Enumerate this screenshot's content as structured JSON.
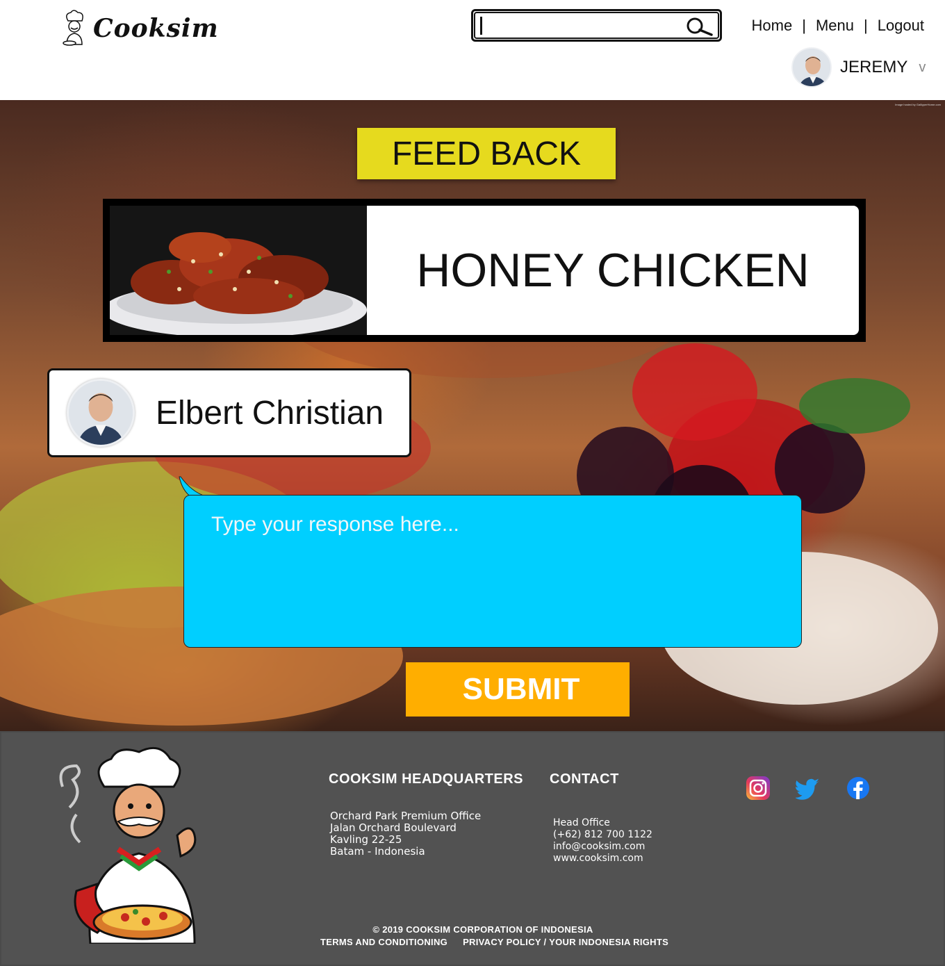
{
  "header": {
    "logo_text": "Cooksim",
    "search": {
      "placeholder": "",
      "value": ""
    },
    "nav": [
      {
        "label": "Home"
      },
      {
        "label": "Menu"
      },
      {
        "label": "Logout"
      }
    ],
    "nav_separator": "|",
    "user": {
      "name": "JEREMY",
      "caret": "v"
    }
  },
  "hero": {
    "credit": "Image hosted by GalliyperHome.com",
    "title": "FEED BACK",
    "dish_name": "HONEY CHICKEN",
    "reviewer_name": "Elbert Christian",
    "response_placeholder": "Type your response here...",
    "submit_label": "SUBMIT"
  },
  "footer": {
    "hq_title": "COOKSIM HEADQUARTERS",
    "hq_lines": [
      "Orchard Park Premium Office",
      "Jalan Orchard Boulevard",
      "Kavling 22-25",
      "Batam - Indonesia"
    ],
    "contact_title": "CONTACT",
    "contact_lines": [
      "Head Office",
      "(+62) 812 700 1122",
      "info@cooksim.com",
      "www.cooksim.com"
    ],
    "social_icons": [
      "instagram-icon",
      "twitter-icon",
      "facebook-icon"
    ],
    "copyright": "© 2019 COOKSIM CORPORATION OF INDONESIA",
    "terms": "TERMS AND CONDITIONING",
    "privacy": "PRIVACY POLICY / YOUR INDONESIA RIGHTS"
  },
  "colors": {
    "title_yellow": "#e6da1e",
    "bubble_cyan": "#00cfff",
    "submit_orange": "#ffae00",
    "footer_gray": "#525252"
  }
}
